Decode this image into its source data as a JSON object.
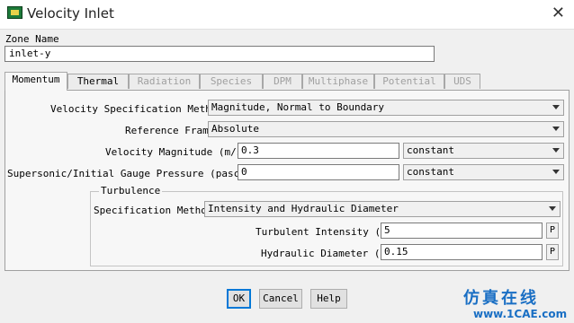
{
  "window": {
    "title": "Velocity Inlet"
  },
  "zone": {
    "label": "Zone Name",
    "value": "inlet-y"
  },
  "tabs": [
    {
      "label": "Momentum",
      "state": "active"
    },
    {
      "label": "Thermal",
      "state": "enabled"
    },
    {
      "label": "Radiation",
      "state": "disabled"
    },
    {
      "label": "Species",
      "state": "disabled"
    },
    {
      "label": "DPM",
      "state": "disabled"
    },
    {
      "label": "Multiphase",
      "state": "disabled"
    },
    {
      "label": "Potential",
      "state": "disabled"
    },
    {
      "label": "UDS",
      "state": "disabled"
    }
  ],
  "momentum": {
    "velocity_spec_method": {
      "label": "Velocity Specification Method",
      "value": "Magnitude, Normal to Boundary"
    },
    "reference_frame": {
      "label": "Reference Frame",
      "value": "Absolute"
    },
    "velocity_magnitude": {
      "label": "Velocity Magnitude (m/s)",
      "value": "0.3",
      "profile": "constant"
    },
    "gauge_pressure": {
      "label": "Supersonic/Initial Gauge Pressure (pascal)",
      "value": "0",
      "profile": "constant"
    },
    "turbulence": {
      "title": "Turbulence",
      "spec_method": {
        "label": "Specification Method",
        "value": "Intensity and Hydraulic Diameter"
      },
      "intensity": {
        "label": "Turbulent Intensity (%)",
        "value": "5",
        "param": "P"
      },
      "hydraulic_diameter": {
        "label": "Hydraulic Diameter (m)",
        "value": "0.15",
        "param": "P"
      }
    }
  },
  "buttons": {
    "ok": "OK",
    "cancel": "Cancel",
    "help": "Help"
  },
  "watermark": {
    "text": "仿真在线",
    "url": "www.1CAE.com"
  },
  "icons": {
    "app": "fluent-app-icon",
    "close": "close-icon",
    "dropdown": "chevron-down-icon"
  }
}
